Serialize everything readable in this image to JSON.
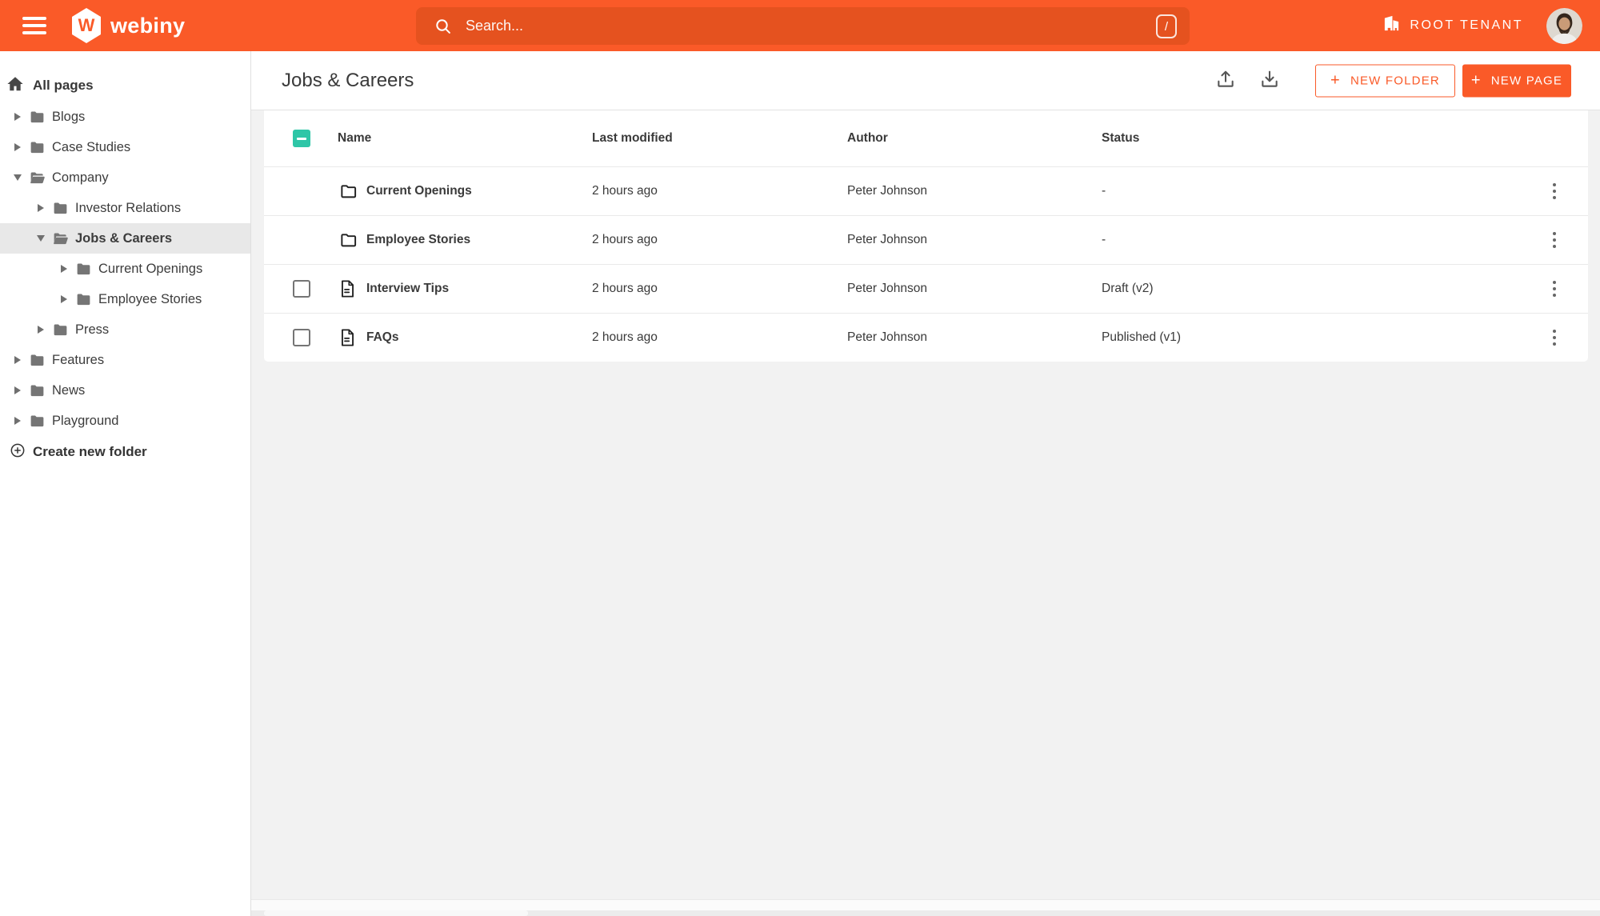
{
  "colors": {
    "accent": "#fa5a28",
    "checkbox_teal": "#2ec6a7",
    "text_dark": "#3a3a3a",
    "icon_gray": "#757575"
  },
  "icons": [
    "hamburger-menu",
    "webiny-hexagon",
    "search",
    "slash-shortcut",
    "building",
    "avatar",
    "home",
    "folder",
    "folder-open",
    "chevron-right",
    "chevron-down",
    "circle-plus",
    "upload",
    "download",
    "plus",
    "checkbox-indeterminate",
    "checkbox-empty",
    "document-page",
    "kebab-menu"
  ],
  "topbar": {
    "brand": "webiny",
    "brand_letter": "W",
    "search_placeholder": "Search...",
    "search_shortcut": "/",
    "tenant": "ROOT TENANT"
  },
  "sidebar": {
    "all_pages": "All pages",
    "items": [
      {
        "label": "Blogs",
        "depth": 0,
        "expanded": false,
        "selected": false
      },
      {
        "label": "Case Studies",
        "depth": 0,
        "expanded": false,
        "selected": false
      },
      {
        "label": "Company",
        "depth": 0,
        "expanded": true,
        "selected": false
      },
      {
        "label": "Investor Relations",
        "depth": 1,
        "expanded": false,
        "selected": false
      },
      {
        "label": "Jobs & Careers",
        "depth": 1,
        "expanded": true,
        "selected": true
      },
      {
        "label": "Current Openings",
        "depth": 2,
        "expanded": false,
        "selected": false
      },
      {
        "label": "Employee Stories",
        "depth": 2,
        "expanded": false,
        "selected": false
      },
      {
        "label": "Press",
        "depth": 1,
        "expanded": false,
        "selected": false
      },
      {
        "label": "Features",
        "depth": 0,
        "expanded": false,
        "selected": false
      },
      {
        "label": "News",
        "depth": 0,
        "expanded": false,
        "selected": false
      },
      {
        "label": "Playground",
        "depth": 0,
        "expanded": false,
        "selected": false
      }
    ],
    "create_folder": "Create new folder"
  },
  "main": {
    "title": "Jobs & Careers",
    "actions": {
      "new_folder": "NEW FOLDER",
      "new_page": "NEW PAGE",
      "plus": "+"
    },
    "table": {
      "columns": [
        "Name",
        "Last modified",
        "Author",
        "Status"
      ],
      "rows": [
        {
          "type": "folder",
          "name": "Current Openings",
          "modified": "2 hours ago",
          "author": "Peter Johnson",
          "status": "-"
        },
        {
          "type": "folder",
          "name": "Employee Stories",
          "modified": "2 hours ago",
          "author": "Peter Johnson",
          "status": "-"
        },
        {
          "type": "page",
          "name": "Interview Tips",
          "modified": "2 hours ago",
          "author": "Peter Johnson",
          "status": "Draft (v2)"
        },
        {
          "type": "page",
          "name": "FAQs",
          "modified": "2 hours ago",
          "author": "Peter Johnson",
          "status": "Published (v1)"
        }
      ]
    }
  }
}
